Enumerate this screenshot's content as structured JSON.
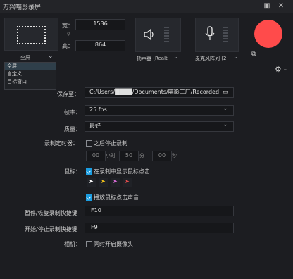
{
  "app": {
    "title": "万兴喵影录屏"
  },
  "window": {
    "restore_icon": "restore-icon",
    "close_icon": "close-icon"
  },
  "capture": {
    "width_label": "宽：",
    "height_label": "高：",
    "width_value": "1536",
    "height_value": "864",
    "mode_selected": "全屏",
    "mode_options": [
      "全屏",
      "自定义",
      "目标窗口"
    ]
  },
  "audio": {
    "speaker_label": "扬声器 (Realt",
    "mic_label": "麦克风阵列 (2"
  },
  "form": {
    "save_label": "保存至：",
    "save_path": "C:/Users/████/Documents/喵影工厂/Recorded",
    "fps_label": "帧率：",
    "fps_value": "25 fps",
    "quality_label": "质量：",
    "quality_value": "最好",
    "timer_label": "录制定时器：",
    "timer_checkbox_label": "之后停止录制",
    "timer_hours": "00",
    "timer_hours_unit": "小时",
    "timer_minutes": "50",
    "timer_minutes_unit": "分",
    "timer_seconds": "00",
    "timer_seconds_unit": "秒",
    "mouse_label": "鼠标：",
    "mouse_show_clicks_label": "在录制中显示鼠标点击",
    "mouse_click_sound_label": "播放鼠标点击声音",
    "pause_hotkey_label": "暂停/恢复录制快捷键",
    "pause_hotkey_value": "F10",
    "start_hotkey_label": "开始/停止录制快捷键",
    "start_hotkey_value": "F9",
    "camera_label": "相机：",
    "camera_checkbox_label": "同时开启摄像头"
  },
  "colors": {
    "record": "#ff4b4b",
    "accent": "#1a9de1",
    "cursor_colors": [
      "#ffffff",
      "#f3c21a",
      "#d86ad7",
      "#e84d4d"
    ]
  }
}
